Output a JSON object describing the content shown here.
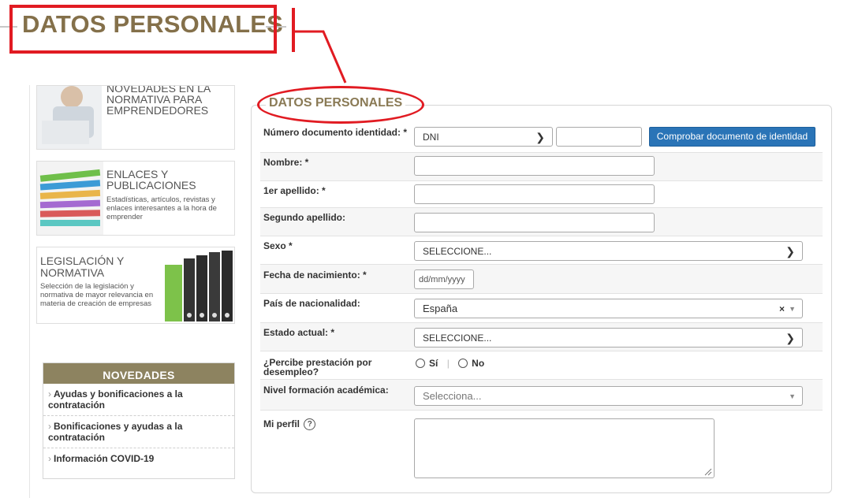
{
  "callout": {
    "title": "DATOS PERSONALES"
  },
  "sidebar": {
    "cards": [
      {
        "title": "NOVEDADES EN LA NORMATIVA PARA EMPRENDEDORES",
        "desc": ""
      },
      {
        "title": "ENLACES Y PUBLICACIONES",
        "desc": "Estadísticas, artículos, revistas y enlaces interesantes a la hora de emprender"
      },
      {
        "title": "LEGISLACIÓN Y NORMATIVA",
        "desc": "Selección de la legislación y normativa de mayor relevancia en materia de creación de empresas"
      }
    ],
    "novedades": {
      "heading": "NOVEDADES",
      "items": [
        "Ayudas y bonificaciones a la contratación",
        "Bonificaciones y ayudas a la contratación",
        "Información COVID-19"
      ]
    }
  },
  "form": {
    "legend": "DATOS PERSONALES",
    "doc": {
      "label": "Número documento identidad: *",
      "type_value": "DNI",
      "number_value": "",
      "check_button": "Comprobar documento de identidad"
    },
    "nombre": {
      "label": "Nombre: *",
      "value": ""
    },
    "apellido1": {
      "label": "1er apellido: *",
      "value": ""
    },
    "apellido2": {
      "label": "Segundo apellido:",
      "value": ""
    },
    "sexo": {
      "label": "Sexo *",
      "value": "SELECCIONE..."
    },
    "nacimiento": {
      "label": "Fecha de nacimiento: *",
      "placeholder": "dd/mm/yyyy"
    },
    "nacionalidad": {
      "label": "País de nacionalidad:",
      "value": "España",
      "clear": "×"
    },
    "estado": {
      "label": "Estado actual: *",
      "value": "SELECCIONE..."
    },
    "prestacion": {
      "label": "¿Percibe prestación por desempleo?",
      "si": "Sí",
      "no": "No",
      "separator": "|"
    },
    "formacion": {
      "label": "Nivel formación académica:",
      "placeholder": "Selecciona..."
    },
    "perfil": {
      "label": "Mi perfil",
      "help": "?"
    }
  },
  "colors": {
    "accent_red": "#e11b22",
    "legend_brown": "#8a7a55",
    "button_blue": "#2a74b7",
    "novedades_bg": "#8d8360"
  }
}
